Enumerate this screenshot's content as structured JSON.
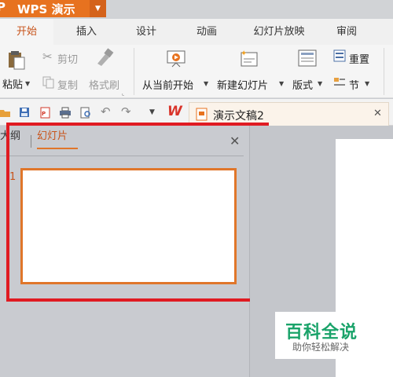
{
  "app": {
    "title": "WPS 演示"
  },
  "tabs": [
    "开始",
    "插入",
    "设计",
    "动画",
    "幻灯片放映",
    "审阅"
  ],
  "ribbon": {
    "paste": "粘贴",
    "cut": "剪切",
    "copy": "复制",
    "format_painter": "格式刷",
    "from_current": "从当前开始",
    "new_slide": "新建幻灯片",
    "layout": "版式",
    "reset": "重置",
    "section": "节"
  },
  "document": {
    "tab_title": "演示文稿2"
  },
  "panel": {
    "tab_outline": "大纲",
    "tab_slides": "幻灯片",
    "slide_number": "1"
  },
  "watermark": {
    "title": "百科全说",
    "subtitle": "助你轻松解决"
  },
  "colors": {
    "accent": "#e7721f",
    "active_tab_text": "#c8541b",
    "highlight_box": "#e01b22",
    "watermark_green": "#1aa36a"
  }
}
